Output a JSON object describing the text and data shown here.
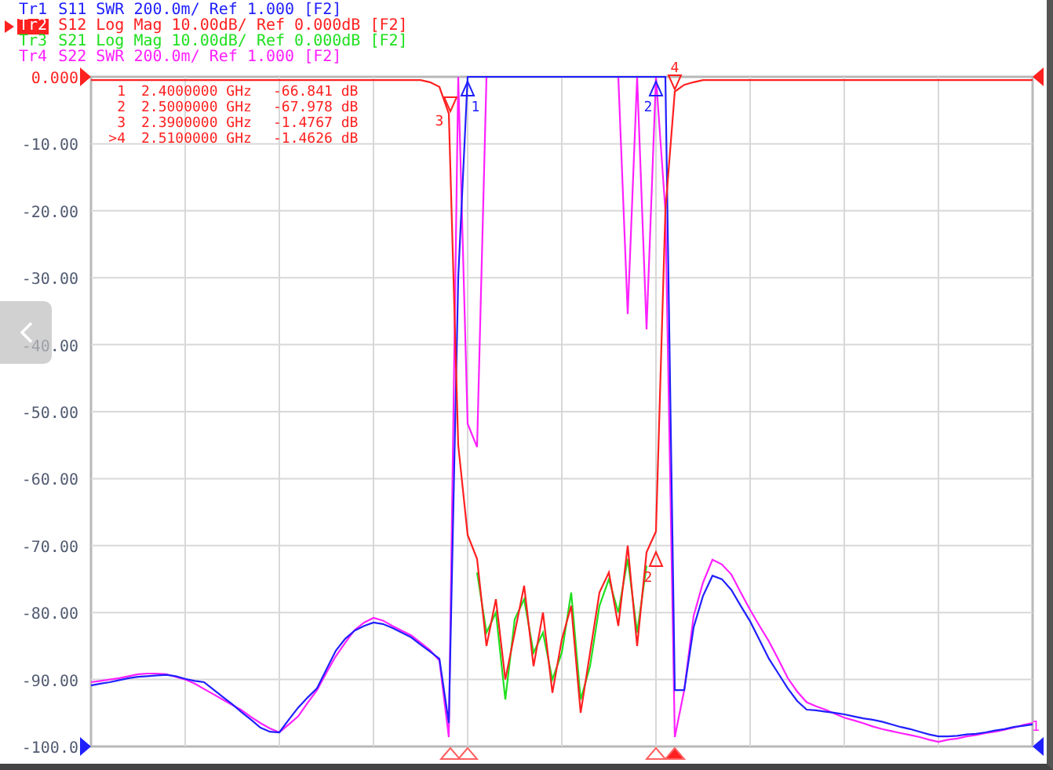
{
  "traces": [
    {
      "name": "Tr1",
      "info": "SWR 200.0m/ Ref 1.000 [F2]",
      "color": "#2020ff",
      "selected": false
    },
    {
      "name": "Tr2",
      "info": "Log Mag 10.00dB/ Ref 0.000dB [F2]",
      "color": "#ff2020",
      "selected": true
    },
    {
      "name": "Tr3",
      "info": "Log Mag 10.00dB/ Ref 0.000dB [F2]",
      "color": "#20e020",
      "selected": false
    },
    {
      "name": "Tr4",
      "info": "SWR 200.0m/ Ref 1.000 [F2]",
      "color": "#ff20ff",
      "selected": false
    }
  ],
  "reference_pointers": [
    {
      "color": "#ff2020",
      "highlight_label": true
    },
    {
      "color": "#2020ff",
      "highlight_label": false
    }
  ],
  "chart_data": {
    "type": "line",
    "grid": true,
    "ylim": [
      -100,
      0
    ],
    "yticks": [
      {
        "value": 0,
        "label": "0.000"
      },
      {
        "value": -10,
        "label": "-10.00"
      },
      {
        "value": -20,
        "label": "-20.00"
      },
      {
        "value": -30,
        "label": "-30.00"
      },
      {
        "value": -40,
        "label": "-40.00"
      },
      {
        "value": -50,
        "label": "-50.00"
      },
      {
        "value": -60,
        "label": "-60.00"
      },
      {
        "value": -70,
        "label": "-70.00"
      },
      {
        "value": -80,
        "label": "-80.00"
      },
      {
        "value": -90,
        "label": "-90.00"
      },
      {
        "value": -100,
        "label": "-100.0"
      }
    ],
    "categories": [
      null,
      null,
      null,
      null,
      null,
      null,
      null,
      null,
      null,
      null,
      null,
      null,
      null,
      null,
      null,
      null,
      null,
      null,
      null,
      null,
      null,
      null,
      null,
      null,
      null,
      null,
      null,
      null,
      null,
      null,
      null,
      null,
      null,
      null,
      null,
      null,
      null,
      null,
      null,
      null,
      null,
      null,
      null,
      null,
      null,
      null,
      null,
      null,
      null,
      null,
      null,
      null,
      null,
      null,
      null,
      null,
      null,
      null,
      null,
      null,
      null,
      null,
      null,
      null,
      null,
      null,
      null,
      null,
      null,
      null,
      null,
      null,
      null,
      null,
      null,
      null,
      null,
      null,
      null,
      null,
      null,
      null,
      null,
      null,
      null,
      null,
      null,
      null,
      null,
      null,
      null,
      null,
      null,
      null,
      null,
      null,
      null,
      null,
      null,
      null,
      null
    ],
    "series": [
      {
        "name": "S11",
        "color": "#2020ff",
        "values": [
          -90.9,
          -90.6,
          -90.4,
          -90.1,
          -89.8,
          -89.6,
          -89.5,
          -89.4,
          -89.3,
          -89.5,
          -89.9,
          -90.2,
          -90.4,
          -91.5,
          -92.6,
          -93.7,
          -94.9,
          -96.0,
          -97.2,
          -97.8,
          -97.9,
          -96.0,
          -94.2,
          -92.7,
          -91.3,
          -88.5,
          -85.7,
          -83.9,
          -82.7,
          -82.0,
          -81.5,
          -81.7,
          -82.3,
          -83.0,
          -83.7,
          -84.8,
          -85.8,
          -86.9,
          -96.5,
          -30,
          0,
          0,
          0,
          0,
          0,
          0,
          0,
          0,
          0,
          0,
          0,
          0,
          0,
          0,
          0,
          0,
          0,
          0,
          0,
          0,
          0,
          0,
          -91.6,
          -91.6,
          -82.2,
          -77.5,
          -74.5,
          -75.0,
          -76.6,
          -79.0,
          -81.3,
          -84.1,
          -86.9,
          -89.1,
          -91.3,
          -93.2,
          -94.5,
          -94.6,
          -94.8,
          -95.0,
          -95.2,
          -95.5,
          -95.8,
          -96.0,
          -96.3,
          -96.7,
          -97.1,
          -97.4,
          -97.8,
          -98.2,
          -98.5,
          -98.5,
          -98.4,
          -98.2,
          -98.1,
          -97.9,
          -97.6,
          -97.4,
          -97.1,
          -96.9,
          -96.7
        ]
      },
      {
        "name": "S12",
        "color": "#ff2020",
        "values": [
          -0.5,
          -0.5,
          -0.5,
          -0.5,
          -0.5,
          -0.5,
          -0.5,
          -0.5,
          -0.5,
          -0.5,
          -0.5,
          -0.5,
          -0.5,
          -0.5,
          -0.5,
          -0.5,
          -0.5,
          -0.5,
          -0.5,
          -0.5,
          -0.5,
          -0.5,
          -0.5,
          -0.5,
          -0.5,
          -0.5,
          -0.5,
          -0.5,
          -0.5,
          -0.5,
          -0.5,
          -0.5,
          -0.5,
          -0.5,
          -0.5,
          -0.5,
          -0.8,
          -1.5,
          -5.5,
          -55,
          -68.4,
          -72,
          -85,
          -78,
          -90,
          -83,
          -76,
          -88,
          -80,
          -92,
          -84,
          -79,
          -95,
          -86,
          -77,
          -74,
          -82,
          -70,
          -85,
          -71,
          -67.9,
          -20,
          -2.2,
          -1.2,
          -0.8,
          -0.5,
          -0.5,
          -0.5,
          -0.5,
          -0.5,
          -0.5,
          -0.5,
          -0.5,
          -0.5,
          -0.5,
          -0.5,
          -0.5,
          -0.5,
          -0.5,
          -0.5,
          -0.5,
          -0.5,
          -0.5,
          -0.5,
          -0.5,
          -0.5,
          -0.5,
          -0.5,
          -0.5,
          -0.5,
          -0.5,
          -0.5,
          -0.5,
          -0.5,
          -0.5,
          -0.5,
          -0.5,
          -0.5,
          -0.5,
          -0.5,
          -0.5
        ]
      },
      {
        "name": "S21",
        "color": "#20e020",
        "values": [
          null,
          null,
          null,
          null,
          null,
          null,
          null,
          null,
          null,
          null,
          null,
          null,
          null,
          null,
          null,
          null,
          null,
          null,
          null,
          null,
          null,
          null,
          null,
          null,
          null,
          null,
          null,
          null,
          null,
          null,
          null,
          null,
          null,
          null,
          null,
          null,
          null,
          null,
          null,
          null,
          null,
          -74,
          -83,
          -80,
          -93,
          -81,
          -78,
          -86,
          -83,
          -90,
          -86,
          -77,
          -93,
          -88,
          -79,
          -75,
          -80,
          -72,
          -83,
          -73,
          null,
          null,
          null,
          null,
          null,
          null,
          null,
          null,
          null,
          null,
          null,
          null,
          null,
          null,
          null,
          null,
          null,
          null,
          null,
          null,
          null,
          null,
          null,
          null,
          null,
          null,
          null,
          null,
          null,
          null,
          null,
          null,
          null,
          null,
          null,
          null,
          null,
          null,
          null,
          null,
          null
        ]
      },
      {
        "name": "S22",
        "color": "#ff20ff",
        "values": [
          -90.4,
          -90.2,
          -90.0,
          -89.8,
          -89.5,
          -89.2,
          -89.1,
          -89.1,
          -89.2,
          -89.6,
          -90.0,
          -90.6,
          -91.4,
          -92.2,
          -93.0,
          -93.8,
          -94.6,
          -95.6,
          -96.5,
          -97.3,
          -97.9,
          -96.7,
          -95.5,
          -93.5,
          -91.6,
          -89.0,
          -86.5,
          -84.5,
          -82.6,
          -81.5,
          -80.8,
          -81.2,
          -82.0,
          -82.7,
          -83.4,
          -84.5,
          -85.6,
          -87.2,
          -98.6,
          0,
          -51.8,
          -55.3,
          0,
          0,
          0,
          0,
          0,
          0,
          0,
          0,
          0,
          0,
          0,
          0,
          0,
          0,
          0,
          -35.4,
          0,
          -37.7,
          0,
          -20,
          -98.6,
          -91.6,
          -80.5,
          -75.5,
          -72.1,
          -72.8,
          -74.3,
          -77.0,
          -79.6,
          -82.0,
          -84.3,
          -87.0,
          -89.8,
          -91.8,
          -93.4,
          -94.0,
          -94.5,
          -95.1,
          -95.7,
          -96.1,
          -96.5,
          -97.0,
          -97.4,
          -97.7,
          -98.0,
          -98.3,
          -98.6,
          -99.0,
          -99.3,
          -99.0,
          -98.8,
          -98.5,
          -98.3,
          -98.0,
          -97.8,
          -97.5,
          -97.2,
          -96.8,
          -96.5
        ]
      }
    ]
  },
  "marker_table": [
    {
      "number": "1",
      "frequency": "2.4000000 GHz",
      "value": "-66.841 dB"
    },
    {
      "number": "2",
      "frequency": "2.5000000 GHz",
      "value": "-67.978 dB"
    },
    {
      "number": "3",
      "frequency": "2.3900000 GHz",
      "value": "-1.4767 dB"
    },
    {
      "number": ">4",
      "frequency": "2.5100000 GHz",
      "value": "-1.4626 dB"
    }
  ],
  "plot_markers": [
    {
      "label": "1",
      "color": "#2020ff"
    },
    {
      "label": "2",
      "color": "#2020ff"
    },
    {
      "label": "3",
      "color": "#ff2020"
    },
    {
      "label": "4",
      "color": "#ff2020"
    },
    {
      "label": "2",
      "color": "#ff2020"
    },
    {
      "label": "1",
      "color": "#ff20ff"
    }
  ]
}
